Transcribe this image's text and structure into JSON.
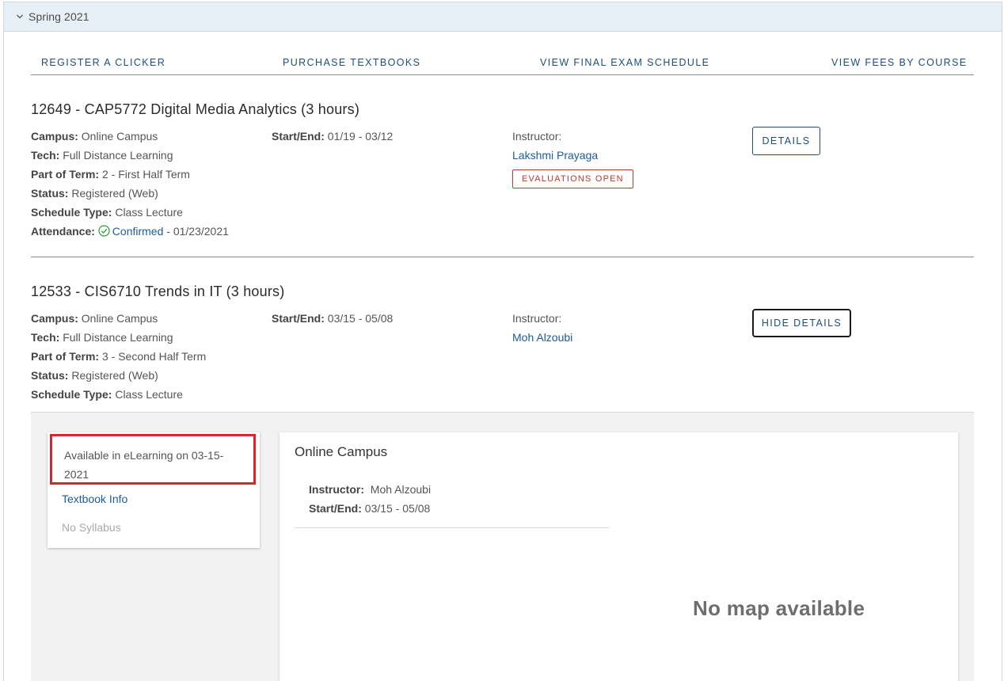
{
  "term": {
    "title": "Spring 2021"
  },
  "links": {
    "register_clicker": "REGISTER A CLICKER",
    "purchase_textbooks": "PURCHASE TEXTBOOKS",
    "final_exam": "VIEW FINAL EXAM SCHEDULE",
    "fees": "VIEW FEES BY COURSE"
  },
  "labels": {
    "campus": "Campus:",
    "tech": "Tech:",
    "part_of_term": "Part of Term:",
    "status": "Status:",
    "schedule_type": "Schedule Type:",
    "attendance": "Attendance:",
    "start_end": "Start/End:",
    "instructor": "Instructor:"
  },
  "courses": [
    {
      "title": "12649 - CAP5772 Digital Media Analytics (3 hours)",
      "campus": "Online Campus",
      "tech": "Full Distance Learning",
      "part_of_term": "2 - First Half Term",
      "status": "Registered (Web)",
      "schedule_type": "Class Lecture",
      "attendance_status": "Confirmed",
      "attendance_date": " - 01/23/2021",
      "start_end": "01/19 - 03/12",
      "instructor": "Lakshmi Prayaga",
      "badge": "EVALUATIONS OPEN",
      "button": "DETAILS"
    },
    {
      "title": "12533 - CIS6710 Trends in IT (3 hours)",
      "campus": "Online Campus",
      "tech": "Full Distance Learning",
      "part_of_term": "3 - Second Half Term",
      "status": "Registered (Web)",
      "schedule_type": "Class Lecture",
      "start_end": "03/15 - 05/08",
      "instructor": "Moh Alzoubi",
      "button": "HIDE DETAILS"
    }
  ],
  "details": {
    "availability": "Available in eLearning on 03-15-2021",
    "textbook": "Textbook Info",
    "syllabus": "No Syllabus",
    "campus": "Online Campus",
    "instructor_label": "Instructor:",
    "instructor": "Moh Alzoubi",
    "start_end_label": "Start/End:",
    "start_end": "03/15 - 05/08",
    "map": "No map available"
  },
  "colors": {
    "link": "#1d4f7c",
    "accent_red": "#c0392b",
    "highlight_box": "#e0232b",
    "header_bg": "#e7f0f7"
  }
}
